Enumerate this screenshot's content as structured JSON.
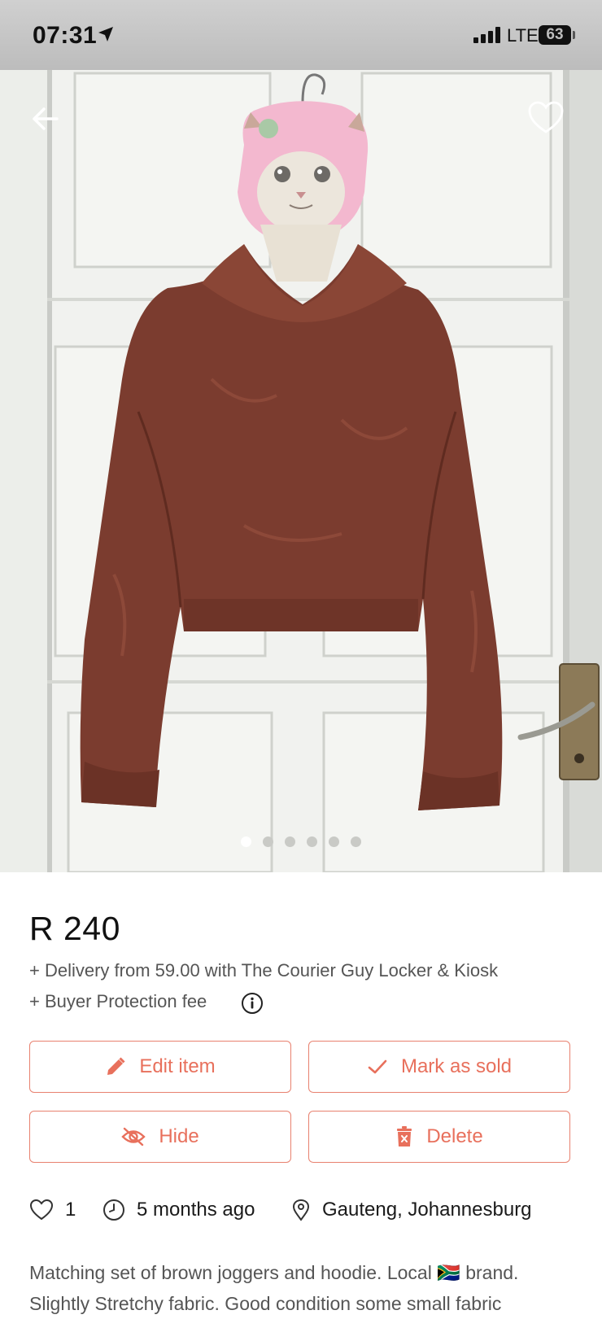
{
  "status_bar": {
    "time": "07:31",
    "network": "LTE",
    "battery": "63"
  },
  "hero": {
    "image_count": 6,
    "active_index": 0,
    "icons": [
      "back-arrow-icon",
      "heart-icon"
    ]
  },
  "listing": {
    "price": "R 240",
    "delivery": "+ Delivery from 59.00 with The Courier Guy Locker & Kiosk",
    "protection": "+ Buyer Protection fee"
  },
  "actions": {
    "edit": "Edit item",
    "sold": "Mark as sold",
    "hide": "Hide",
    "delete": "Delete"
  },
  "meta": {
    "likes": "1",
    "posted": "5 months ago",
    "location": "Gauteng, Johannesburg"
  },
  "description": {
    "line1": "Matching set of brown joggers and hoodie. Local 🇿🇦 brand.",
    "line2": "Slightly Stretchy fabric. Good condition some small fabric"
  },
  "colors": {
    "accent": "#e8705c",
    "muted_text": "#555555",
    "sweater": "#7a3b2e"
  }
}
